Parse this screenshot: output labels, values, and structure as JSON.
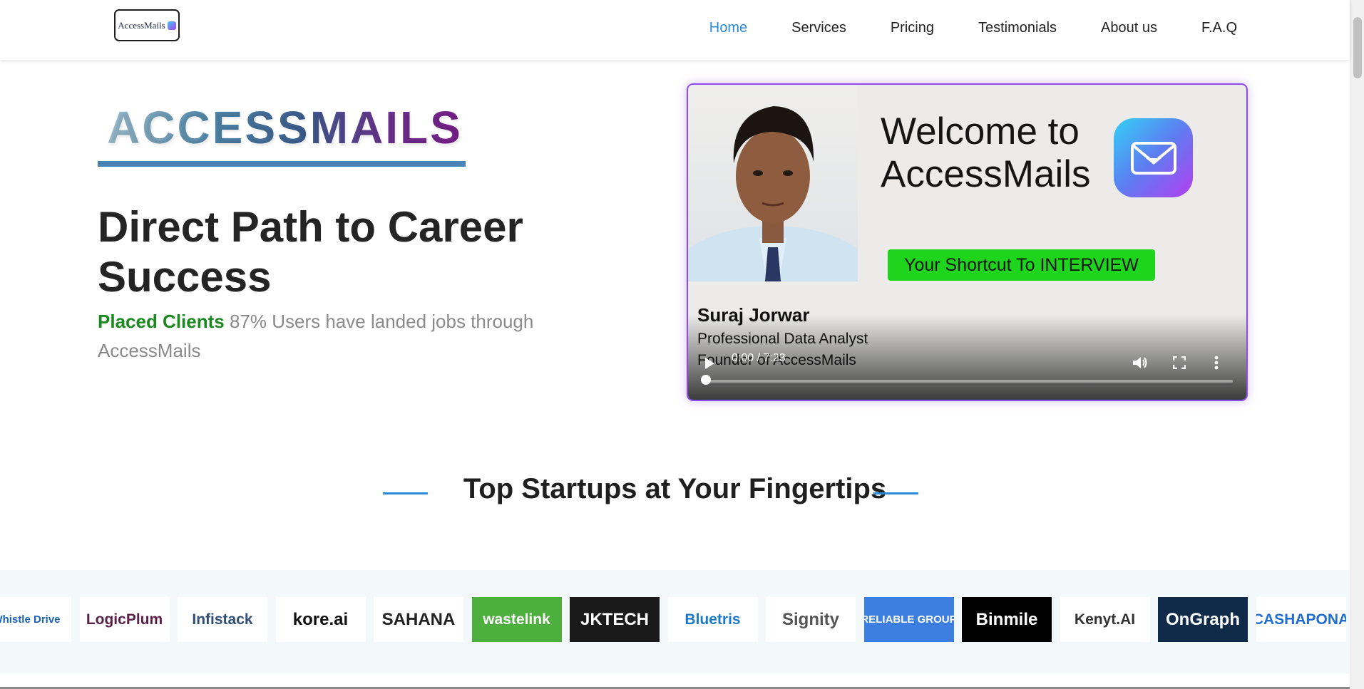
{
  "header": {
    "logo_text": "AccessMails",
    "nav": [
      {
        "label": "Home",
        "active": true
      },
      {
        "label": "Services"
      },
      {
        "label": "Pricing"
      },
      {
        "label": "Testimonials"
      },
      {
        "label": "About us"
      },
      {
        "label": "F.A.Q"
      }
    ]
  },
  "hero": {
    "brand": "ACCESSMAILS",
    "headline": "Direct Path to Career Success",
    "placed_label": "Placed Clients",
    "placed_text": "87% Users have landed jobs through AccessMails"
  },
  "video": {
    "welcome_line1": "Welcome to",
    "welcome_line2": "AccessMails",
    "shortcut": "Your Shortcut To INTERVIEW",
    "person_name": "Suraj Jorwar",
    "person_role": "Professional Data Analyst",
    "person_role2": "Founder of AccessMails",
    "time": "0:00 / 7:23",
    "progress": 0
  },
  "startups": {
    "title": "Top Startups at Your Fingertips",
    "logos": [
      {
        "name": "Whistle Drive",
        "color": "#1b63b5",
        "bg": "#ffffff"
      },
      {
        "name": "LogicPlum",
        "color": "#5b1f4a",
        "bg": "#ffffff"
      },
      {
        "name": "Infistack",
        "color": "#2f4e73",
        "bg": "#ffffff"
      },
      {
        "name": "kore.ai",
        "color": "#111111",
        "bg": "#ffffff"
      },
      {
        "name": "SAHANA",
        "color": "#222222",
        "bg": "#ffffff"
      },
      {
        "name": "wastelink",
        "color": "#ffffff",
        "bg": "#4caf3e"
      },
      {
        "name": "JKTECH",
        "color": "#ffffff",
        "bg": "#1a1a1a"
      },
      {
        "name": "Bluetris",
        "color": "#1a7ac9",
        "bg": "#ffffff"
      },
      {
        "name": "Signity",
        "color": "#555555",
        "bg": "#ffffff"
      },
      {
        "name": "RELIABLE GROUP",
        "color": "#ffffff",
        "bg": "#3c7fe0"
      },
      {
        "name": "Binmile",
        "color": "#ffffff",
        "bg": "#000000"
      },
      {
        "name": "Kenyt.AI",
        "color": "#333333",
        "bg": "#ffffff"
      },
      {
        "name": "OnGraph",
        "color": "#ffffff",
        "bg": "#102a4a"
      },
      {
        "name": "CASHAPONA",
        "color": "#1f6ed4",
        "bg": "#ffffff"
      }
    ]
  },
  "colors": {
    "accent": "#2d8ad8",
    "green": "#1a8a1f",
    "video_border": "#8a4cf0"
  }
}
